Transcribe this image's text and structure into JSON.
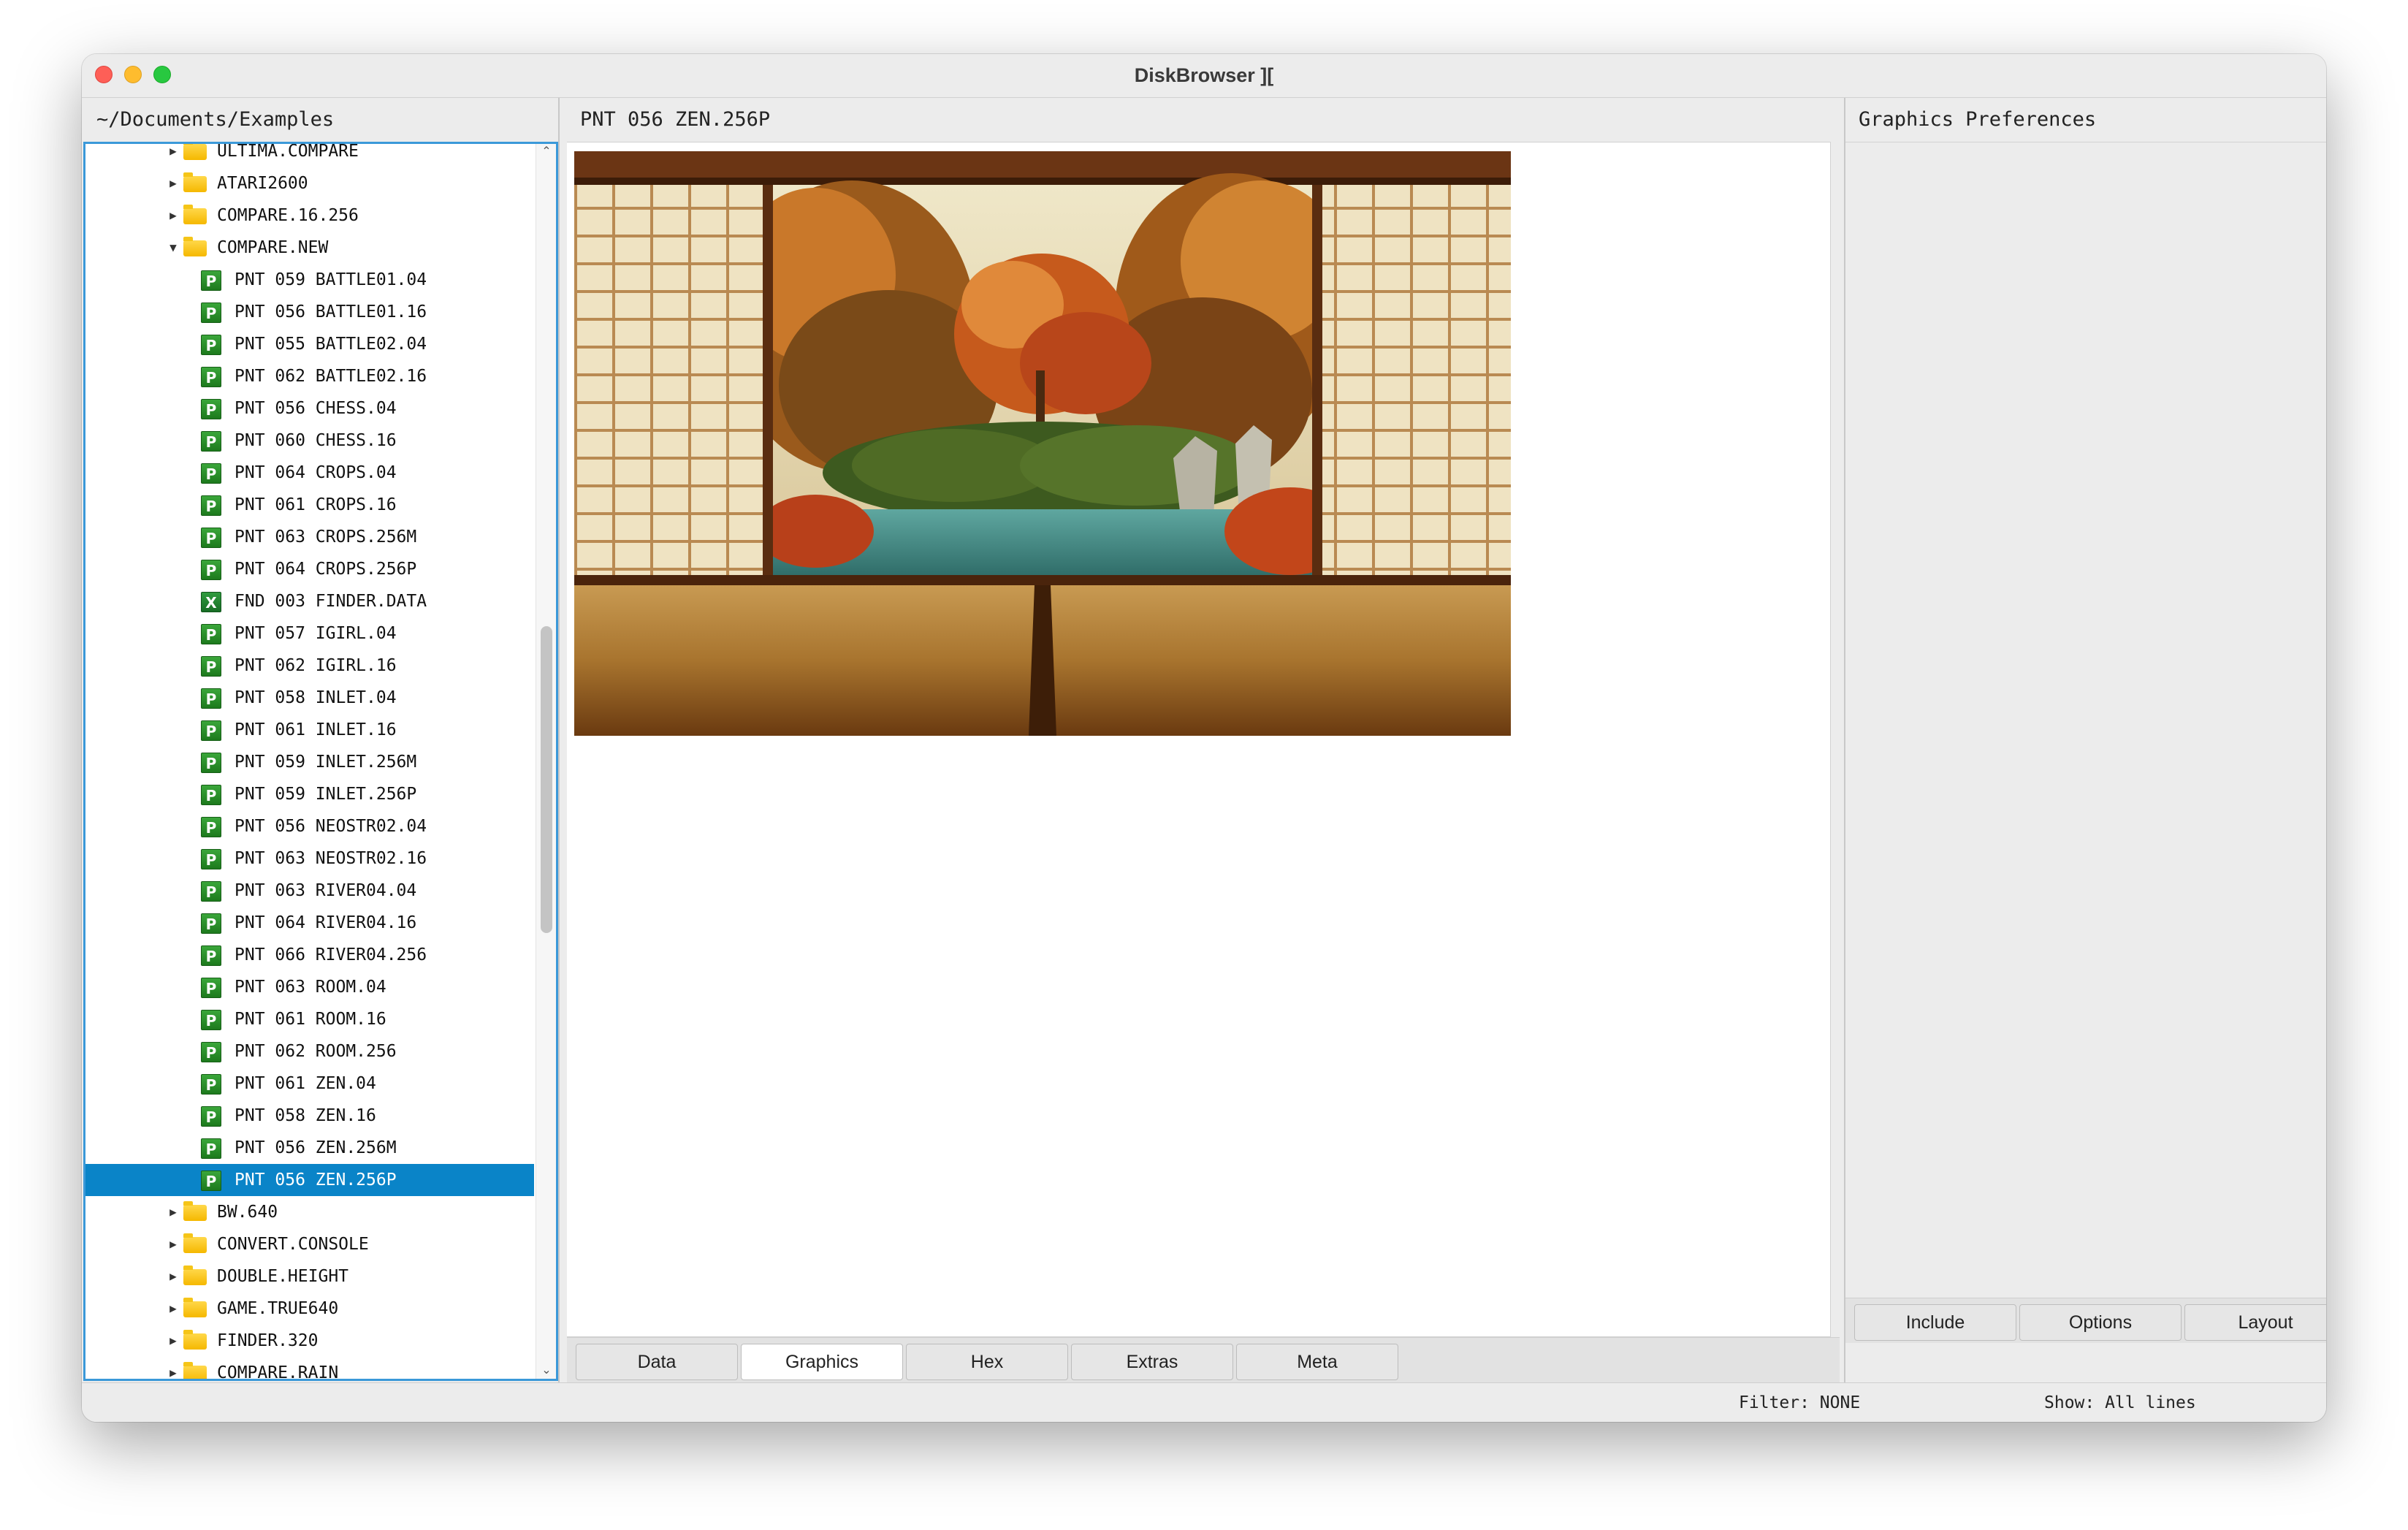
{
  "window": {
    "title": "DiskBrowser ]["
  },
  "left": {
    "header": "~/Documents/Examples",
    "tree": [
      {
        "kind": "folder",
        "label": "ULTIMA.COMPARE",
        "expanded": false
      },
      {
        "kind": "folder",
        "label": "ATARI2600",
        "expanded": false
      },
      {
        "kind": "folder",
        "label": "COMPARE.16.256",
        "expanded": false
      },
      {
        "kind": "folder",
        "label": "COMPARE.NEW",
        "expanded": true
      },
      {
        "kind": "file",
        "icon": "P",
        "label": "PNT 059 BATTLE01.04"
      },
      {
        "kind": "file",
        "icon": "P",
        "label": "PNT 056 BATTLE01.16"
      },
      {
        "kind": "file",
        "icon": "P",
        "label": "PNT 055 BATTLE02.04"
      },
      {
        "kind": "file",
        "icon": "P",
        "label": "PNT 062 BATTLE02.16"
      },
      {
        "kind": "file",
        "icon": "P",
        "label": "PNT 056 CHESS.04"
      },
      {
        "kind": "file",
        "icon": "P",
        "label": "PNT 060 CHESS.16"
      },
      {
        "kind": "file",
        "icon": "P",
        "label": "PNT 064 CROPS.04"
      },
      {
        "kind": "file",
        "icon": "P",
        "label": "PNT 061 CROPS.16"
      },
      {
        "kind": "file",
        "icon": "P",
        "label": "PNT 063 CROPS.256M"
      },
      {
        "kind": "file",
        "icon": "P",
        "label": "PNT 064 CROPS.256P"
      },
      {
        "kind": "file",
        "icon": "X",
        "label": "FND 003 FINDER.DATA"
      },
      {
        "kind": "file",
        "icon": "P",
        "label": "PNT 057 IGIRL.04"
      },
      {
        "kind": "file",
        "icon": "P",
        "label": "PNT 062 IGIRL.16"
      },
      {
        "kind": "file",
        "icon": "P",
        "label": "PNT 058 INLET.04"
      },
      {
        "kind": "file",
        "icon": "P",
        "label": "PNT 061 INLET.16"
      },
      {
        "kind": "file",
        "icon": "P",
        "label": "PNT 059 INLET.256M"
      },
      {
        "kind": "file",
        "icon": "P",
        "label": "PNT 059 INLET.256P"
      },
      {
        "kind": "file",
        "icon": "P",
        "label": "PNT 056 NEOSTR02.04"
      },
      {
        "kind": "file",
        "icon": "P",
        "label": "PNT 063 NEOSTR02.16"
      },
      {
        "kind": "file",
        "icon": "P",
        "label": "PNT 063 RIVER04.04"
      },
      {
        "kind": "file",
        "icon": "P",
        "label": "PNT 064 RIVER04.16"
      },
      {
        "kind": "file",
        "icon": "P",
        "label": "PNT 066 RIVER04.256"
      },
      {
        "kind": "file",
        "icon": "P",
        "label": "PNT 063 ROOM.04"
      },
      {
        "kind": "file",
        "icon": "P",
        "label": "PNT 061 ROOM.16"
      },
      {
        "kind": "file",
        "icon": "P",
        "label": "PNT 062 ROOM.256"
      },
      {
        "kind": "file",
        "icon": "P",
        "label": "PNT 061 ZEN.04"
      },
      {
        "kind": "file",
        "icon": "P",
        "label": "PNT 058 ZEN.16"
      },
      {
        "kind": "file",
        "icon": "P",
        "label": "PNT 056 ZEN.256M"
      },
      {
        "kind": "file",
        "icon": "P",
        "label": "PNT 056 ZEN.256P",
        "selected": true
      },
      {
        "kind": "folder",
        "label": "BW.640",
        "expanded": false
      },
      {
        "kind": "folder",
        "label": "CONVERT.CONSOLE",
        "expanded": false
      },
      {
        "kind": "folder",
        "label": "DOUBLE.HEIGHT",
        "expanded": false
      },
      {
        "kind": "folder",
        "label": "GAME.TRUE640",
        "expanded": false
      },
      {
        "kind": "folder",
        "label": "FINDER.320",
        "expanded": false
      },
      {
        "kind": "folder",
        "label": "COMPARE.RAIN",
        "expanded": false
      }
    ]
  },
  "center": {
    "header": "PNT 056 ZEN.256P",
    "tabs": [
      "Data",
      "Graphics",
      "Hex",
      "Extras",
      "Meta"
    ],
    "active_tab": "Graphics"
  },
  "right": {
    "header": "Graphics Preferences",
    "tabs": [
      "Include",
      "Options",
      "Layout"
    ]
  },
  "status": {
    "filter": "Filter: NONE",
    "show": "Show: All lines"
  },
  "colors": {
    "selection": "#0a84c8",
    "focus_border": "#3b99d9",
    "traffic_close": "#fe5f57",
    "traffic_min": "#febc2e",
    "traffic_max": "#28c840"
  }
}
